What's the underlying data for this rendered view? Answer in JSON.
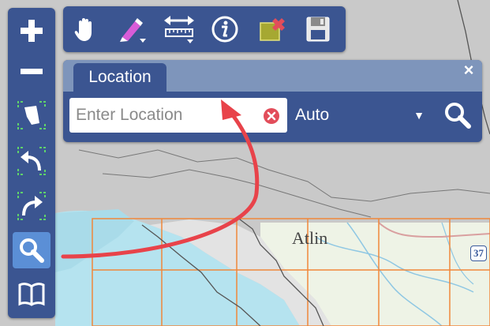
{
  "map": {
    "place_label": "Atlin",
    "highway_shield": "37",
    "colors": {
      "water": "#b5e3ef",
      "land": "#c9c9c9",
      "topo": "#eef3e6",
      "grid": "#f0873a",
      "border": "#555555"
    }
  },
  "left_toolbar": {
    "buttons": [
      {
        "icon": "zoom-in-icon"
      },
      {
        "icon": "zoom-out-icon"
      },
      {
        "icon": "full-extent-icon"
      },
      {
        "icon": "previous-extent-icon"
      },
      {
        "icon": "next-extent-icon"
      },
      {
        "icon": "search-icon",
        "active": true
      },
      {
        "icon": "book-icon"
      }
    ],
    "color": "#3b5591",
    "active_color": "#5b8fd6"
  },
  "top_toolbar": {
    "buttons": [
      {
        "icon": "pan-hand-icon"
      },
      {
        "icon": "draw-pen-icon"
      },
      {
        "icon": "measure-ruler-icon"
      },
      {
        "icon": "info-icon"
      },
      {
        "icon": "clear-graphics-icon"
      },
      {
        "icon": "save-disk-icon"
      }
    ]
  },
  "location_panel": {
    "tab_label": "Location",
    "close_symbol": "×",
    "input_placeholder": "Enter Location",
    "input_value": "",
    "mode_selected": "Auto",
    "mode_arrow": "▼"
  },
  "annotation": {
    "color": "#e8434a"
  }
}
